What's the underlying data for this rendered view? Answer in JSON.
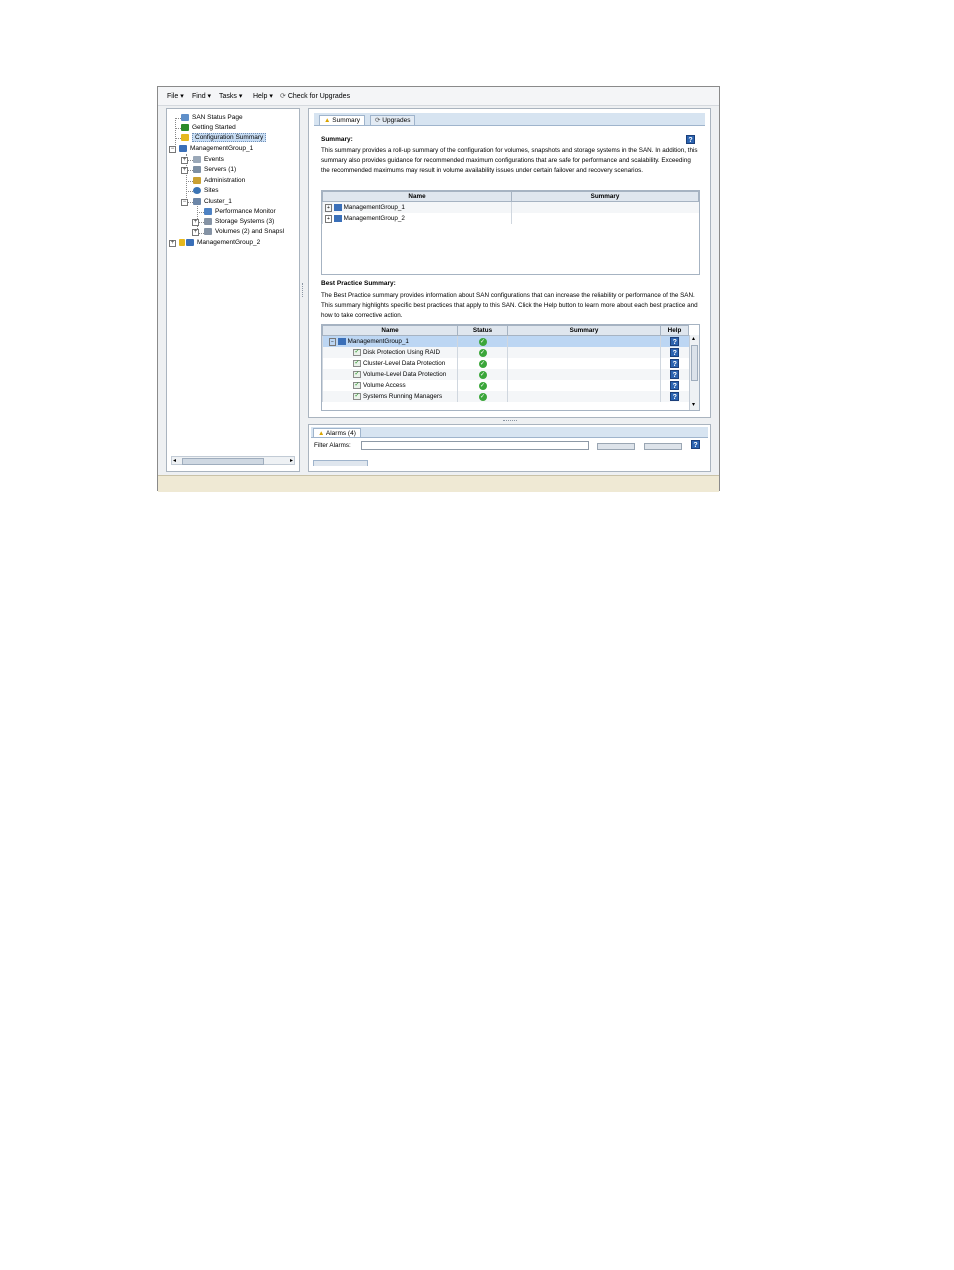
{
  "menu": {
    "items": [
      "File ▾",
      "Find ▾",
      "Tasks ▾",
      "Help ▾"
    ],
    "check_upgrades": "Check for Upgrades"
  },
  "tree": {
    "san_status": "SAN Status Page",
    "getting_started": "Getting Started",
    "config_summary": "Configuration Summary",
    "mg1": "ManagementGroup_1",
    "events": "Events",
    "servers": "Servers (1)",
    "administration": "Administration",
    "sites": "Sites",
    "cluster": "Cluster_1",
    "perf_monitor": "Performance Monitor",
    "storage_systems": "Storage Systems (3)",
    "volumes": "Volumes (2) and Snapsl",
    "mg2": "ManagementGroup_2"
  },
  "tabs": {
    "summary": "Summary",
    "upgrades": "Upgrades"
  },
  "summary": {
    "heading": "Summary:",
    "text": "This summary provides a roll-up summary of the configuration for volumes, snapshots and storage systems in the SAN. In addition, this summary also provides guidance for recommended maximum configurations that are safe for performance and scalability. Exceeding the recommended maximums may result in volume availability issues under certain failover and recovery scenarios.",
    "columns": [
      "Name",
      "Summary"
    ],
    "rows": [
      "ManagementGroup_1",
      "ManagementGroup_2"
    ]
  },
  "best_practice": {
    "heading": "Best Practice Summary:",
    "text": "The Best Practice summary provides information about SAN configurations that can increase the reliability or performance of the SAN. This summary highlights specific best practices that apply to this SAN. Click the Help button to learn more about each best practice and how to take corrective action.",
    "columns": [
      "Name",
      "Status",
      "Summary",
      "Help"
    ],
    "rows": [
      "ManagementGroup_1",
      "Disk Protection Using RAID",
      "Cluster-Level Data Protection",
      "Volume-Level Data Protection",
      "Volume Access",
      "Systems Running Managers"
    ]
  },
  "alarms": {
    "tab": "Alarms (4)",
    "filter_label": "Filter Alarms:",
    "filter_value": ""
  },
  "help_glyph": "?"
}
